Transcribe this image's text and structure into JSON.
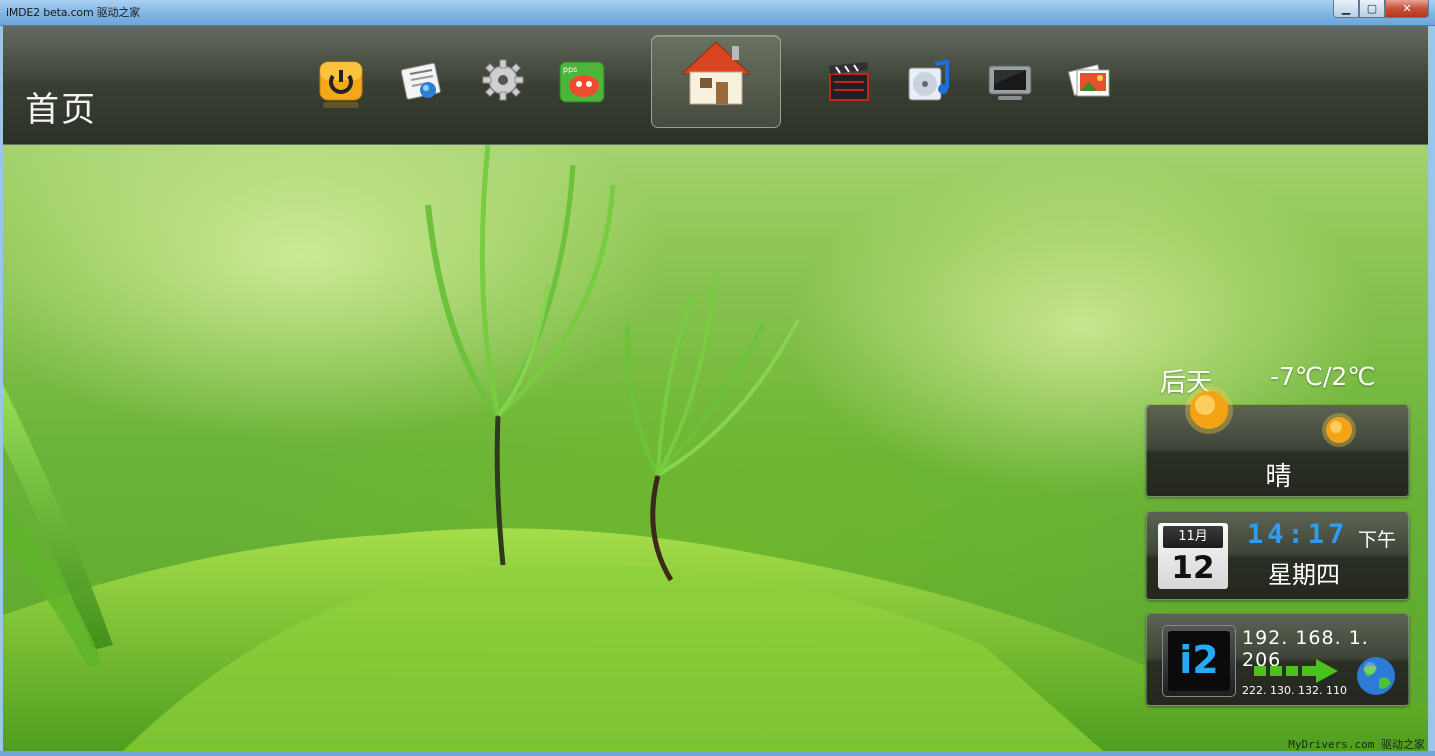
{
  "window": {
    "title": "iMDE2 beta.com  驱动之家",
    "minimize": "▁",
    "maximize": "▢",
    "close": "✕"
  },
  "header": {
    "page_title": "首页",
    "nav_icons": [
      {
        "name": "power",
        "icon": "power-icon"
      },
      {
        "name": "news",
        "icon": "news-icon"
      },
      {
        "name": "settings",
        "icon": "gear-icon"
      },
      {
        "name": "pps",
        "icon": "pps-icon"
      },
      {
        "name": "home",
        "icon": "home-icon",
        "selected": true
      },
      {
        "name": "video",
        "icon": "clapperboard-icon"
      },
      {
        "name": "music",
        "icon": "music-icon"
      },
      {
        "name": "tv",
        "icon": "tv-icon"
      },
      {
        "name": "photos",
        "icon": "photos-icon"
      }
    ]
  },
  "weather": {
    "day": "后天",
    "temperature": "-7℃/2℃",
    "condition": "晴"
  },
  "clock": {
    "month": "11月",
    "day": "12",
    "time": "14:17",
    "ampm": "下午",
    "weekday": "星期四"
  },
  "network": {
    "logo": "i2",
    "lan_ip": "192. 168. 1. 206",
    "wan_ip": "222. 130. 132. 110"
  },
  "watermark": "MyDrivers.com 驱动之家"
}
